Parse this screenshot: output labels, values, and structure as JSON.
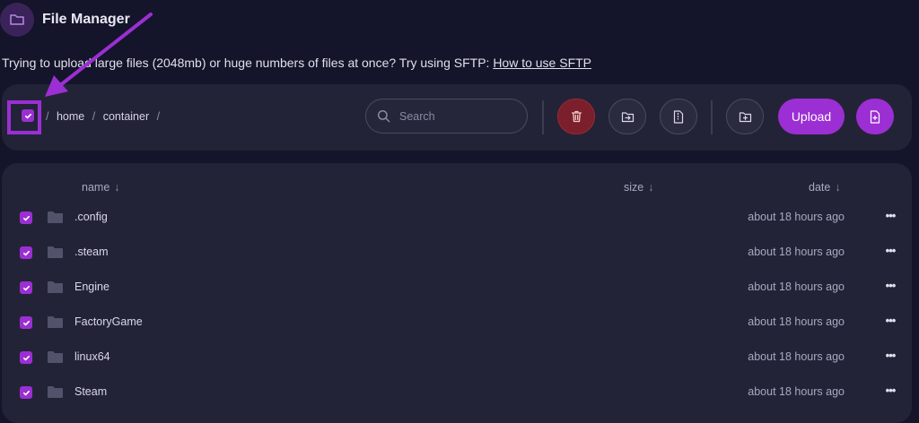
{
  "header": {
    "title": "File Manager",
    "icon": "folder-icon"
  },
  "notice": {
    "text": "Trying to upload large files (2048mb) or huge numbers of files at once? Try using SFTP: ",
    "link": "How to use SFTP"
  },
  "toolbar": {
    "select_all_checked": true,
    "breadcrumb": [
      "home",
      "container"
    ],
    "search_placeholder": "Search",
    "upload_label": "Upload",
    "buttons": [
      "delete-icon",
      "move-icon",
      "archive-icon",
      "new-folder-icon",
      "new-file-icon"
    ]
  },
  "table": {
    "columns": {
      "name": "name",
      "size": "size",
      "date": "date"
    },
    "sort_arrow": "↓",
    "rows": [
      {
        "name": ".config",
        "size": "",
        "date": "about 18 hours ago",
        "checked": true
      },
      {
        "name": ".steam",
        "size": "",
        "date": "about 18 hours ago",
        "checked": true
      },
      {
        "name": "Engine",
        "size": "",
        "date": "about 18 hours ago",
        "checked": true
      },
      {
        "name": "FactoryGame",
        "size": "",
        "date": "about 18 hours ago",
        "checked": true
      },
      {
        "name": "linux64",
        "size": "",
        "date": "about 18 hours ago",
        "checked": true
      },
      {
        "name": "Steam",
        "size": "",
        "date": "about 18 hours ago",
        "checked": true
      }
    ]
  },
  "colors": {
    "background": "#14142a",
    "panel": "#232338",
    "accent": "#9b2fd3",
    "danger": "#7a1f2b"
  }
}
